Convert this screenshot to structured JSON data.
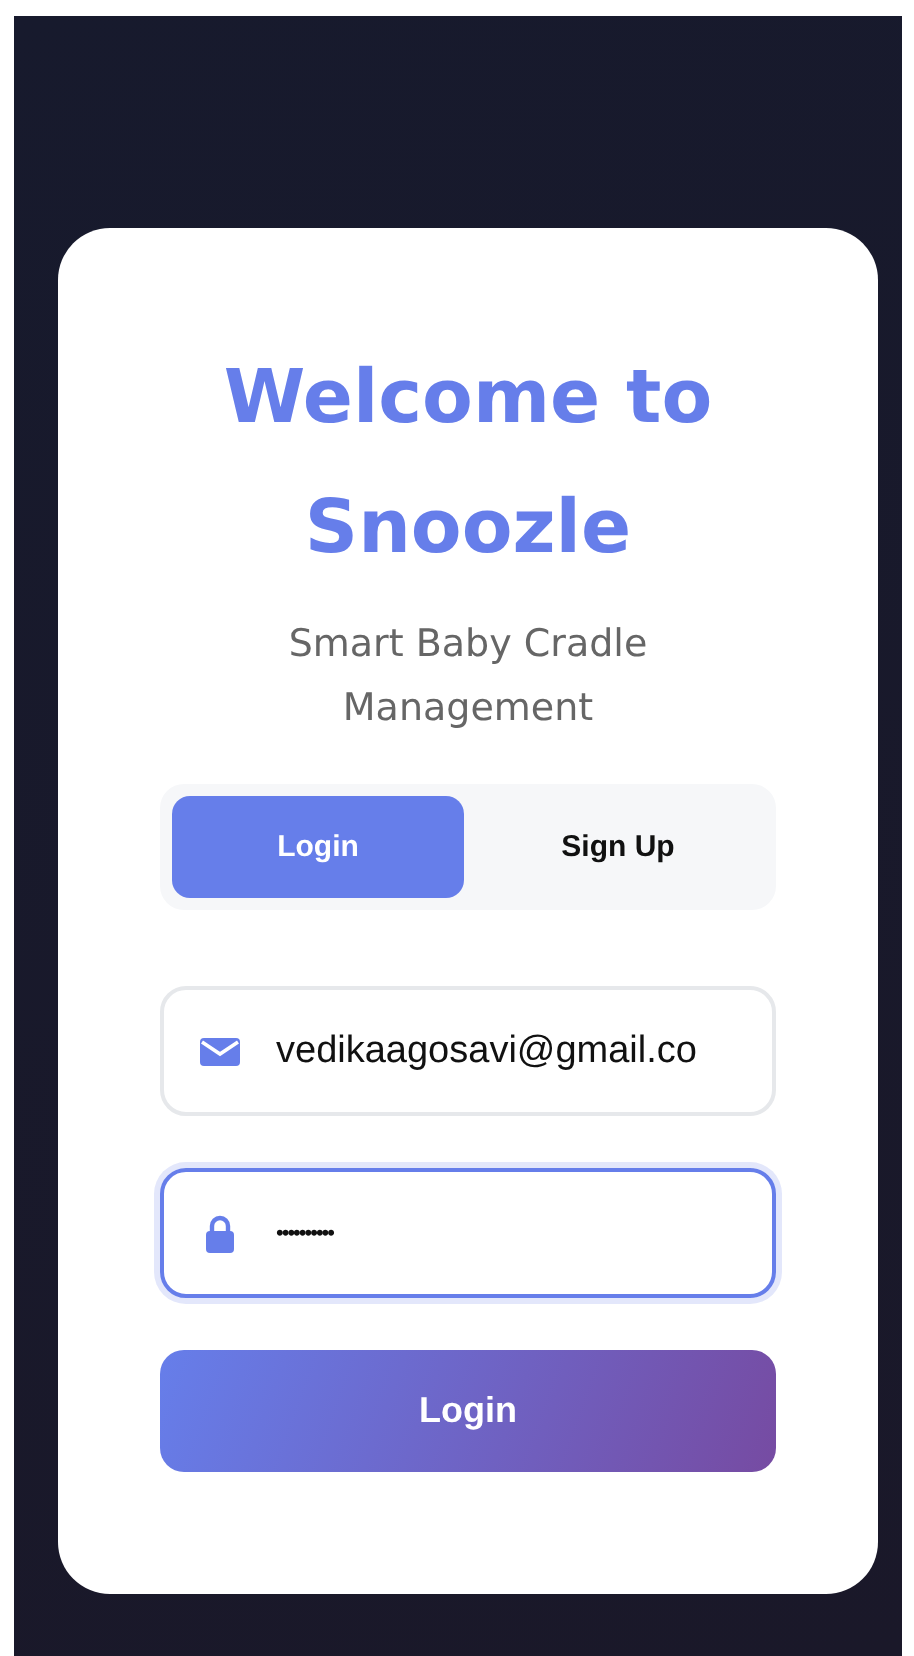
{
  "title": "Welcome to Snoozle",
  "subtitle": "Smart Baby Cradle Management",
  "tabs": [
    {
      "label": "Login",
      "selected": true
    },
    {
      "label": "Sign Up",
      "selected": false
    }
  ],
  "fields": [
    {
      "kind": "email",
      "value": "vedikaagosavi@gmail.co",
      "focused": false
    },
    {
      "kind": "password",
      "value": "••••••••••",
      "focused": true
    }
  ],
  "submit_button": "Login"
}
